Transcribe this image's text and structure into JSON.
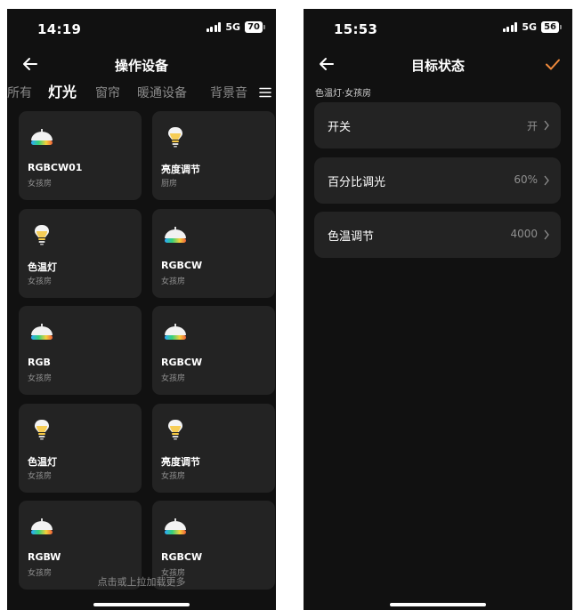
{
  "left": {
    "status": {
      "time": "14:19",
      "network": "5G",
      "battery": "70"
    },
    "title": "操作设备",
    "tabs": [
      "所有",
      "灯光",
      "窗帘",
      "暖通设备",
      "背景音"
    ],
    "active_tab": "灯光",
    "devices": [
      {
        "name": "RGBCW01",
        "room": "女孩房",
        "icon": "rgb-lamp-icon"
      },
      {
        "name": "亮度调节",
        "room": "厨房",
        "icon": "bulb-icon"
      },
      {
        "name": "色温灯",
        "room": "女孩房",
        "icon": "bulb-icon"
      },
      {
        "name": "RGBCW",
        "room": "女孩房",
        "icon": "rgb-lamp-icon"
      },
      {
        "name": "RGB",
        "room": "女孩房",
        "icon": "rgb-lamp-icon"
      },
      {
        "name": "RGBCW",
        "room": "女孩房",
        "icon": "rgb-lamp-icon"
      },
      {
        "name": "色温灯",
        "room": "女孩房",
        "icon": "bulb-icon"
      },
      {
        "name": "亮度调节",
        "room": "女孩房",
        "icon": "bulb-icon"
      },
      {
        "name": "RGBW",
        "room": "女孩房",
        "icon": "rgb-lamp-icon"
      },
      {
        "name": "RGBCW",
        "room": "女孩房",
        "icon": "rgb-lamp-icon"
      }
    ],
    "load_more": "点击或上拉加载更多"
  },
  "right": {
    "status": {
      "time": "15:53",
      "network": "5G",
      "battery": "56"
    },
    "title": "目标状态",
    "subtitle": "色温灯·女孩房",
    "rows": [
      {
        "label": "开关",
        "value": "开"
      },
      {
        "label": "百分比调光",
        "value": "60%"
      },
      {
        "label": "色温调节",
        "value": "4000"
      }
    ]
  },
  "colors": {
    "background": "#111111",
    "card": "#232323",
    "accent": "#f08a3c",
    "muted": "#8f8f8f"
  }
}
